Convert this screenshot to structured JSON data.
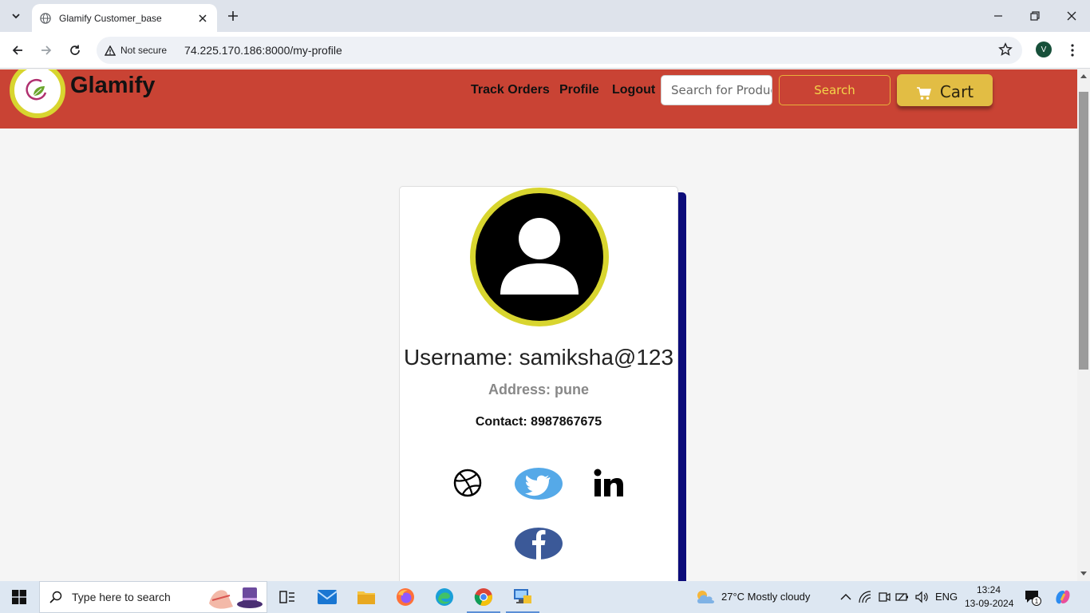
{
  "browser": {
    "tab_title": "Glamify Customer_base",
    "security_label": "Not secure",
    "url": "74.225.170.186:8000/my-profile",
    "profile_initial": "V"
  },
  "site": {
    "brand": "Glamify",
    "nav": {
      "track_orders": "Track Orders",
      "profile": "Profile",
      "logout": "Logout"
    },
    "search_placeholder": "Search for Products",
    "search_button": "Search",
    "cart_label": "Cart",
    "colors": {
      "header_bg": "#c94334",
      "accent_yellow": "#d8d52f",
      "card_shadow": "#0c0c7a"
    }
  },
  "profile": {
    "username": "Username: samiksha@123",
    "address": "Address: pune",
    "contact": "Contact: 8987867675",
    "social_icons": [
      "dribbble-icon",
      "twitter-icon",
      "linkedin-icon",
      "facebook-icon"
    ]
  },
  "taskbar": {
    "search_placeholder": "Type here to search",
    "weather": "27°C  Mostly cloudy",
    "language": "ENG",
    "time": "13:24",
    "date": "13-09-2024",
    "notification_count": "1"
  }
}
